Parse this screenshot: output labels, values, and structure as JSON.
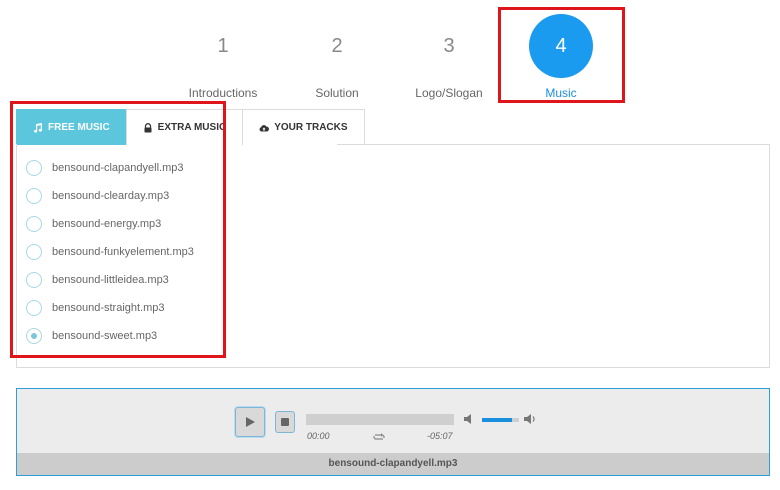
{
  "steps": [
    {
      "number": "1",
      "label": "Introductions"
    },
    {
      "number": "2",
      "label": "Solution"
    },
    {
      "number": "3",
      "label": "Logo/Slogan"
    },
    {
      "number": "4",
      "label": "Music",
      "active": true
    }
  ],
  "tabs": [
    {
      "label": "FREE MUSIC",
      "icon": "music-note-icon",
      "active": true
    },
    {
      "label": "EXTRA MUSIC",
      "icon": "lock-icon"
    },
    {
      "label": "YOUR TRACKS",
      "icon": "cloud-upload-icon"
    }
  ],
  "tracks": [
    {
      "name": "bensound-clapandyell.mp3",
      "selected": false
    },
    {
      "name": "bensound-clearday.mp3",
      "selected": false
    },
    {
      "name": "bensound-energy.mp3",
      "selected": false
    },
    {
      "name": "bensound-funkyelement.mp3",
      "selected": false
    },
    {
      "name": "bensound-littleidea.mp3",
      "selected": false
    },
    {
      "name": "bensound-straight.mp3",
      "selected": false
    },
    {
      "name": "bensound-sweet.mp3",
      "selected": true
    }
  ],
  "player": {
    "current_time": "00:00",
    "duration": "-05:07",
    "progress": 0.0,
    "volume": 0.8,
    "now_playing": "bensound-clapandyell.mp3"
  },
  "colors": {
    "accent": "#1a9bef",
    "tab_active": "#5bc6dc",
    "highlight": "#e0141b"
  }
}
